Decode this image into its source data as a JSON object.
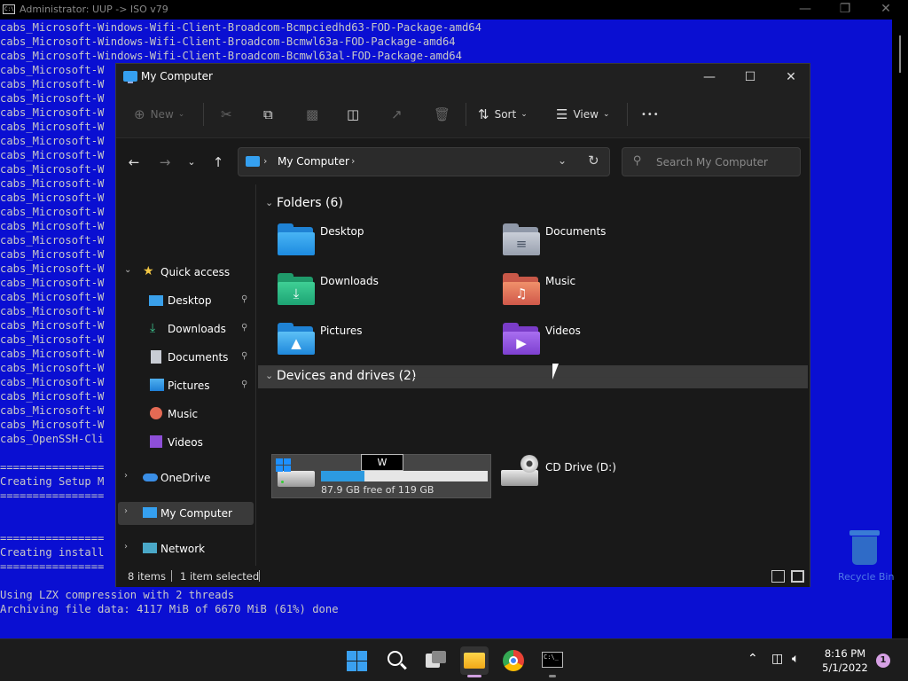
{
  "console": {
    "title": "Administrator:  UUP -> ISO v79",
    "lines": [
      "cabs_Microsoft-Windows-Wifi-Client-Broadcom-Bcmpciedhd63-FOD-Package-amd64",
      "cabs_Microsoft-Windows-Wifi-Client-Broadcom-Bcmwl63a-FOD-Package-amd64",
      "cabs_Microsoft-Windows-Wifi-Client-Broadcom-Bcmwl63al-FOD-Package-amd64",
      "cabs_Microsoft-W",
      "cabs_Microsoft-W",
      "cabs_Microsoft-W",
      "cabs_Microsoft-W",
      "cabs_Microsoft-W",
      "cabs_Microsoft-W",
      "cabs_Microsoft-W",
      "cabs_Microsoft-W",
      "cabs_Microsoft-W",
      "cabs_Microsoft-W",
      "cabs_Microsoft-W",
      "cabs_Microsoft-W",
      "cabs_Microsoft-W",
      "cabs_Microsoft-W",
      "cabs_Microsoft-W",
      "cabs_Microsoft-W",
      "cabs_Microsoft-W",
      "cabs_Microsoft-W",
      "cabs_Microsoft-W",
      "cabs_Microsoft-W",
      "cabs_Microsoft-W",
      "cabs_Microsoft-W",
      "cabs_Microsoft-W",
      "cabs_Microsoft-W",
      "cabs_Microsoft-W",
      "cabs_Microsoft-W",
      "cabs_OpenSSH-Cli",
      "",
      "================",
      "Creating Setup M",
      "================",
      "",
      "",
      "================",
      "Creating install",
      "================",
      "",
      "Using LZX compression with 2 threads",
      "Archiving file data: 4117 MiB of 6670 MiB (61%) done"
    ]
  },
  "desktop": {
    "recycle_bin_label": "Recycle Bin"
  },
  "explorer": {
    "title": "My Computer",
    "toolbar": {
      "new_label": "New",
      "sort_label": "Sort",
      "view_label": "View",
      "more_glyph": "•••"
    },
    "address": {
      "location": "My Computer",
      "search_placeholder": "Search My Computer"
    },
    "nav": {
      "quick_access": "Quick access",
      "items": [
        "Desktop",
        "Downloads",
        "Documents",
        "Pictures",
        "Music",
        "Videos"
      ],
      "onedrive": "OneDrive",
      "my_computer": "My Computer",
      "network": "Network"
    },
    "folders_group": "Folders (6)",
    "folders": [
      "Desktop",
      "Documents",
      "Downloads",
      "Music",
      "Pictures",
      "Videos"
    ],
    "drives_group": "Devices and drives (2)",
    "drive_c": {
      "rename_value": "W",
      "free_text": "87.9 GB free of 119 GB",
      "free_gb": 87.9,
      "total_gb": 119
    },
    "drive_d": {
      "label": "CD Drive (D:)"
    },
    "status": {
      "items": "8 items",
      "selected": "1 item selected"
    }
  },
  "taskbar": {
    "time": "8:16 PM",
    "date": "5/1/2022",
    "notification_count": "1"
  },
  "colors": {
    "console_bg": "#0a0fd2",
    "explorer_bg": "#191919",
    "accent": "#2c9ae0"
  }
}
